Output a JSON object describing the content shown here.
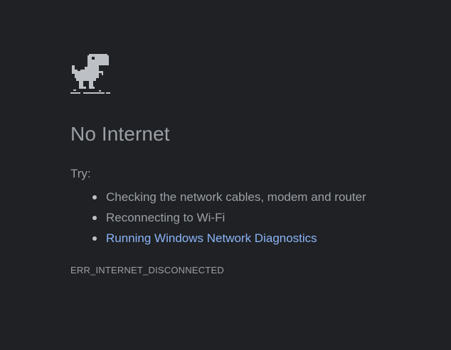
{
  "page": {
    "title": "No Internet",
    "try_label": "Try:",
    "suggestions": [
      {
        "text": "Checking the network cables, modem and router",
        "link": false
      },
      {
        "text": "Reconnecting to Wi-Fi",
        "link": false
      },
      {
        "text": "Running Windows Network Diagnostics",
        "link": true
      }
    ],
    "error_code": "ERR_INTERNET_DISCONNECTED"
  },
  "icons": {
    "dino": "offline-dinosaur-icon"
  },
  "colors": {
    "background": "#202124",
    "text": "#9aa0a6",
    "link": "#8ab4f8"
  }
}
